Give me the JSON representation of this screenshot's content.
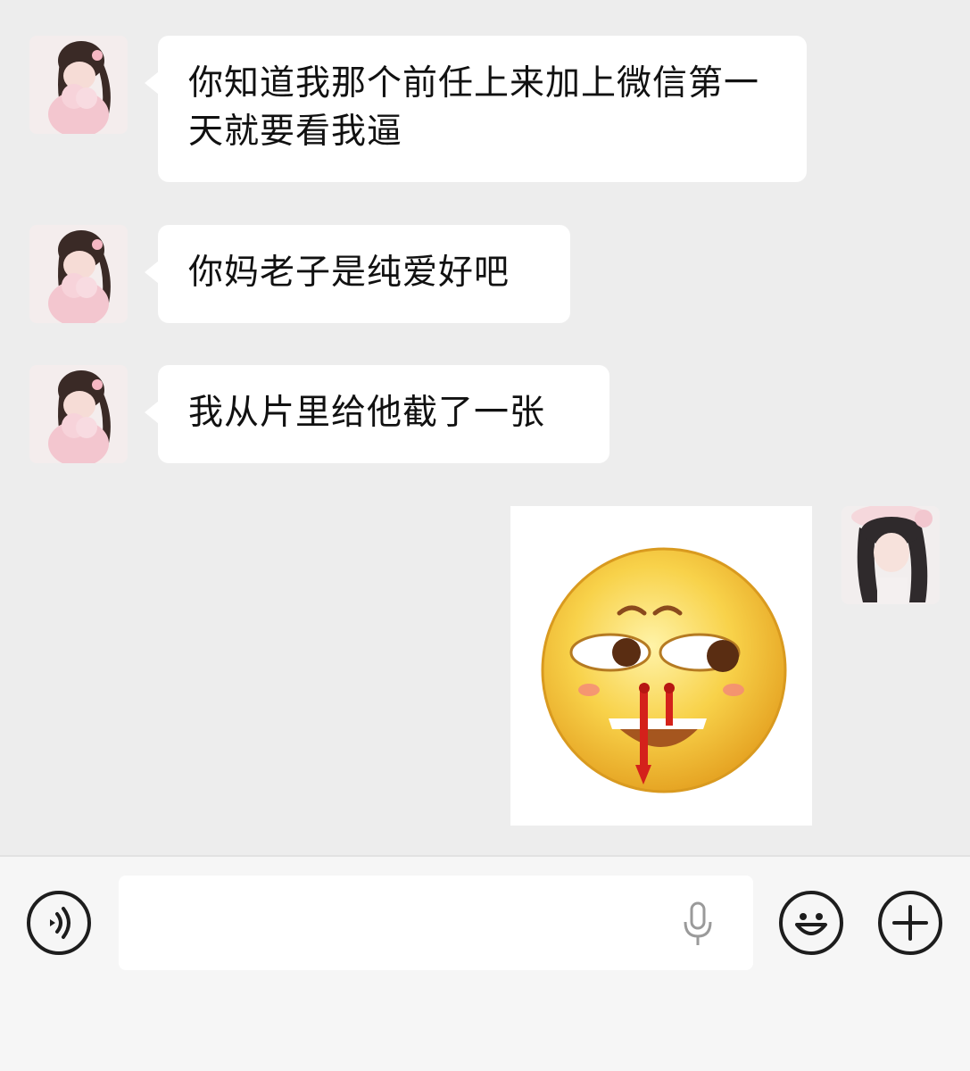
{
  "messages": [
    {
      "side": "left",
      "avatar": "contact-avatar",
      "text": "你知道我那个前任上来加上微信第一天就要看我逼"
    },
    {
      "side": "left",
      "avatar": "contact-avatar",
      "text": "你妈老子是纯爱好吧"
    },
    {
      "side": "left",
      "avatar": "contact-avatar",
      "text": "我从片里给他截了一张"
    },
    {
      "side": "right",
      "avatar": "self-avatar",
      "sticker": "nosebleed-smiley-sticker"
    }
  ],
  "input_bar": {
    "voice_toggle_icon": "voice-toggle-icon",
    "input_value": "",
    "mic_icon": "microphone-icon",
    "emoji_icon": "emoji-icon",
    "plus_icon": "plus-icon"
  },
  "colors": {
    "background": "#ededed",
    "bubble": "#ffffff",
    "input_bar": "#f6f6f6",
    "icon": "#1d1d1d"
  }
}
